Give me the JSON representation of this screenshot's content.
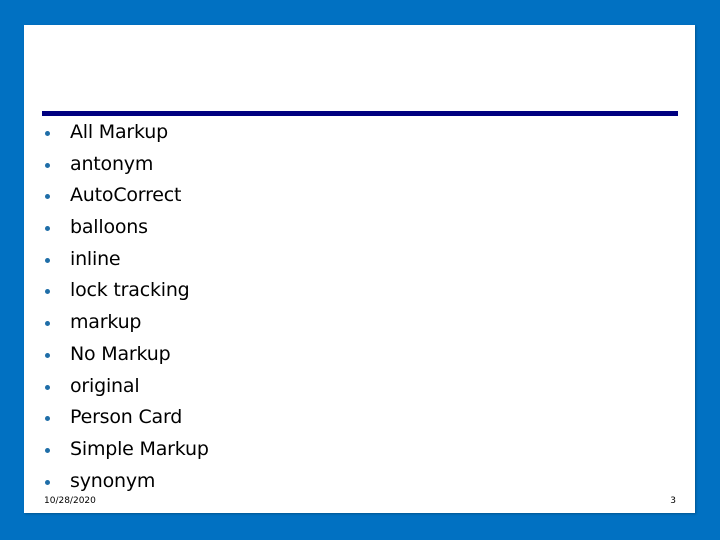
{
  "slide": {
    "title": "",
    "bullets": [
      "All Markup",
      "antonym",
      "AutoCorrect",
      "balloons",
      "inline",
      "lock tracking",
      "markup",
      "No Markup",
      "original",
      "Person Card",
      "Simple Markup",
      "synonym"
    ],
    "footer": {
      "date": "10/28/2020",
      "page_number": "3"
    }
  },
  "colors": {
    "background": "#0171c2",
    "rule": "#000080",
    "bullet": "#1f6ea8"
  }
}
